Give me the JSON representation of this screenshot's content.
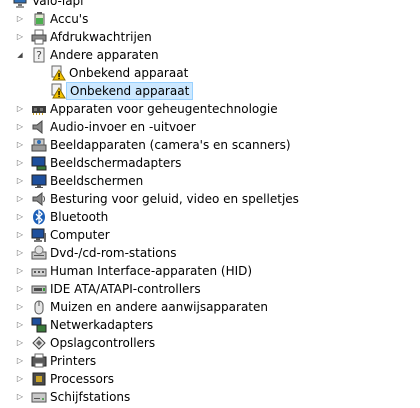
{
  "tree": {
    "root": {
      "label": "Valo-lapi",
      "icon": "computer-icon"
    },
    "categories": [
      {
        "label": "Accu's",
        "icon": "battery-icon"
      },
      {
        "label": "Afdrukwachtrijen",
        "icon": "printer-icon"
      },
      {
        "label": "Andere apparaten",
        "icon": "unknown-device-icon",
        "expanded": true
      },
      {
        "label": "Apparaten voor geheugentechnologie",
        "icon": "memory-device-icon"
      },
      {
        "label": "Audio-invoer en -uitvoer",
        "icon": "speaker-icon"
      },
      {
        "label": "Beeldapparaten (camera's en scanners)",
        "icon": "camera-scanner-icon"
      },
      {
        "label": "Beeldschermadapters",
        "icon": "display-adapter-icon"
      },
      {
        "label": "Beeldschermen",
        "icon": "monitor-icon"
      },
      {
        "label": "Besturing voor geluid, video en spelletjes",
        "icon": "speaker-icon"
      },
      {
        "label": "Bluetooth",
        "icon": "bluetooth-icon"
      },
      {
        "label": "Computer",
        "icon": "computer-icon"
      },
      {
        "label": "Dvd-/cd-rom-stations",
        "icon": "optical-drive-icon"
      },
      {
        "label": "Human Interface-apparaten (HID)",
        "icon": "hid-icon"
      },
      {
        "label": "IDE ATA/ATAPI-controllers",
        "icon": "ide-controller-icon"
      },
      {
        "label": "Muizen en andere aanwijsapparaten",
        "icon": "mouse-icon"
      },
      {
        "label": "Netwerkadapters",
        "icon": "network-adapter-icon"
      },
      {
        "label": "Opslagcontrollers",
        "icon": "storage-controller-icon"
      },
      {
        "label": "Printers",
        "icon": "printer-icon"
      },
      {
        "label": "Processors",
        "icon": "processor-icon"
      },
      {
        "label": "Schijfstations",
        "icon": "disk-drive-icon"
      }
    ],
    "other_devices_children": [
      {
        "label": "Onbekend apparaat",
        "icon": "warning-device-icon",
        "selected": false
      },
      {
        "label": "Onbekend apparaat",
        "icon": "warning-device-icon",
        "selected": true
      }
    ]
  },
  "colors": {
    "selection_background": "#cce8ff",
    "selection_border": "#99d1ff",
    "warning_yellow": "#f5c400"
  }
}
